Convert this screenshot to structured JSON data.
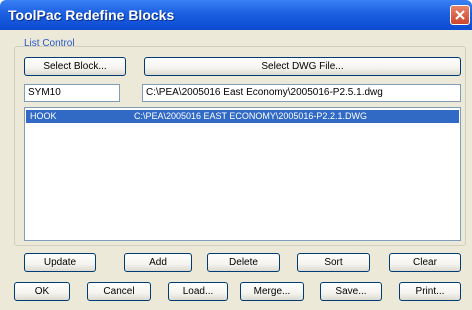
{
  "window": {
    "title": "ToolPac Redefine Blocks"
  },
  "group": {
    "label": "List Control"
  },
  "buttons": {
    "select_block": "Select Block...",
    "select_dwg": "Select DWG File..."
  },
  "fields": {
    "block_name": "SYM10",
    "dwg_path": "C:\\PEA\\2005016 East Economy\\2005016-P2.5.1.dwg"
  },
  "list": {
    "rows": [
      {
        "block": "HOOK",
        "file": "C:\\PEA\\2005016 EAST ECONOMY\\2005016-P2.2.1.DWG",
        "selected": true
      }
    ]
  },
  "list_actions": {
    "update": "Update",
    "add": "Add",
    "delete": "Delete",
    "sort": "Sort",
    "clear": "Clear"
  },
  "dialog_actions": {
    "ok": "OK",
    "cancel": "Cancel",
    "load": "Load...",
    "merge": "Merge...",
    "save": "Save...",
    "print": "Print..."
  },
  "colors": {
    "titlebar": "#0b4bd2",
    "selection": "#316ac5",
    "dialog_bg": "#ece9d8"
  }
}
